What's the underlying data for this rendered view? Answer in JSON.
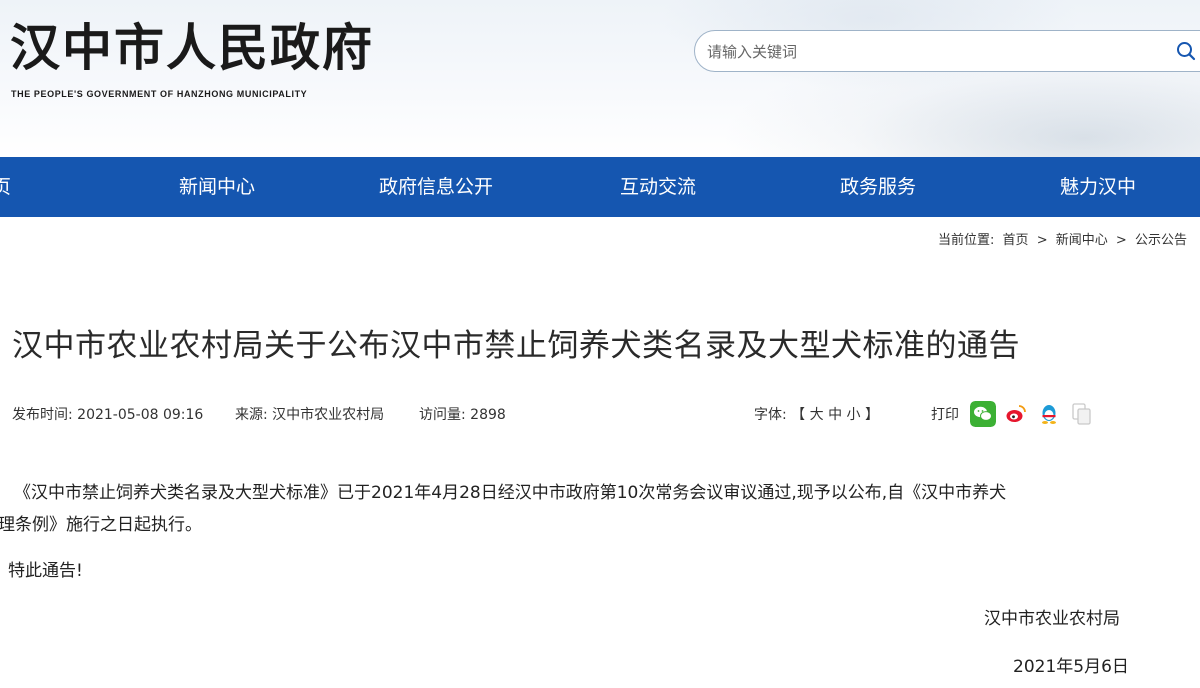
{
  "header": {
    "logo_cn": "汉中市人民政府",
    "logo_en": "THE PEOPLE'S GOVERNMENT OF HANZHONG MUNICIPALITY",
    "search_placeholder": "请输入关键词"
  },
  "nav": {
    "items": [
      "页",
      "新闻中心",
      "政府信息公开",
      "互动交流",
      "政务服务",
      "魅力汉中"
    ]
  },
  "breadcrumb": {
    "label": "当前位置:",
    "items": [
      "首页",
      ">",
      "新闻中心",
      ">",
      "公示公告"
    ]
  },
  "article": {
    "title": "汉中市农业农村局关于公布汉中市禁止饲养犬类名录及大型犬标准的通告",
    "meta": {
      "publish_label": "发布时间:",
      "publish_time": "2021-05-08 09:16",
      "source_label": "来源:",
      "source": "汉中市农业农村局",
      "views_label": "访问量:",
      "views": "2898",
      "font_label": "字体:",
      "font_options": "【 大 中 小 】",
      "print_label": "打印"
    },
    "body_line1": "《汉中市禁止饲养犬类名录及大型犬标准》已于2021年4月28日经汉中市政府第10次常务会议审议通过,现予以公布,自《汉中市养犬",
    "body_line2": "理条例》施行之日起执行。",
    "notice": "特此通告!",
    "signature": "汉中市农业农村局",
    "date": "2021年5月6日"
  },
  "share": {
    "icons": [
      "wechat-icon",
      "weibo-icon",
      "qq-icon",
      "copy-icon"
    ],
    "colors": {
      "wechat": "#3cb034",
      "weibo": "#e6162d",
      "qq": "#1d9bd7"
    }
  },
  "colors": {
    "nav_bg": "#1556b0",
    "text": "#222222"
  }
}
